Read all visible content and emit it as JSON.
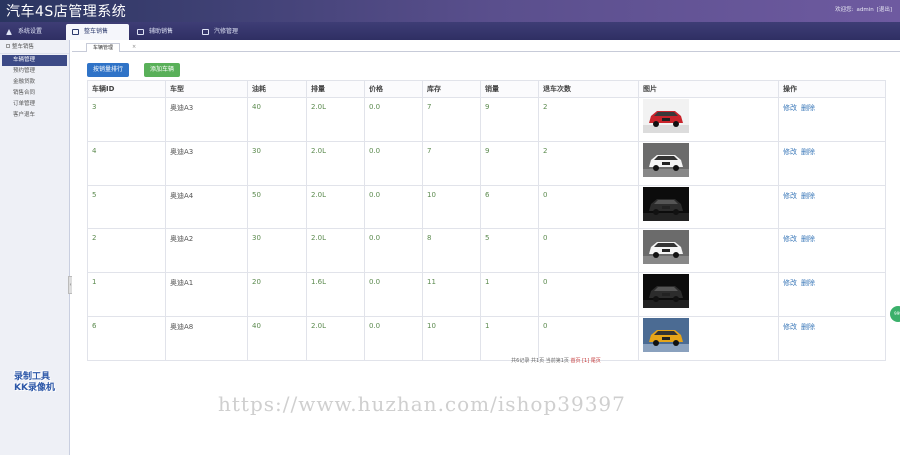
{
  "header": {
    "app_title": "汽车4S店管理系统",
    "welcome": "欢迎您:",
    "username": "admin",
    "logout": "[退出]"
  },
  "nav": {
    "tabs": [
      {
        "label": "系统设置",
        "icon": "home-icon"
      },
      {
        "label": "整车销售",
        "icon": "list-icon",
        "active": true
      },
      {
        "label": "辅助销售",
        "icon": "list-icon"
      },
      {
        "label": "汽修管理",
        "icon": "list-icon"
      }
    ]
  },
  "sidebar": {
    "heading": "整车销售",
    "items": [
      {
        "label": "车辆管理",
        "active": true
      },
      {
        "label": "预约管理"
      },
      {
        "label": "金融贷款"
      },
      {
        "label": "销售合同"
      },
      {
        "label": "订单管理"
      },
      {
        "label": "客户退车"
      }
    ]
  },
  "content": {
    "page_tab_label": "车辆管理",
    "page_tab_close": "×",
    "sort_button": "按销量排行",
    "add_button": "添加车辆"
  },
  "table": {
    "columns": [
      "车辆ID",
      "车型",
      "油耗",
      "排量",
      "价格",
      "库存",
      "销量",
      "退车次数",
      "图片",
      "操作"
    ],
    "rows": [
      {
        "id": "3",
        "model": "奥迪A3",
        "fuel": "40",
        "displacement": "2.0L",
        "price": "0.0",
        "stock": "7",
        "sales": "9",
        "returns": "2",
        "image": "red-car"
      },
      {
        "id": "4",
        "model": "奥迪A3",
        "fuel": "30",
        "displacement": "2.0L",
        "price": "0.0",
        "stock": "7",
        "sales": "9",
        "returns": "2",
        "image": "white-car"
      },
      {
        "id": "5",
        "model": "奥迪A4",
        "fuel": "50",
        "displacement": "2.0L",
        "price": "0.0",
        "stock": "10",
        "sales": "6",
        "returns": "0",
        "image": "black-car"
      },
      {
        "id": "2",
        "model": "奥迪A2",
        "fuel": "30",
        "displacement": "2.0L",
        "price": "0.0",
        "stock": "8",
        "sales": "5",
        "returns": "0",
        "image": "white-car"
      },
      {
        "id": "1",
        "model": "奥迪A1",
        "fuel": "20",
        "displacement": "1.6L",
        "price": "0.0",
        "stock": "11",
        "sales": "1",
        "returns": "0",
        "image": "black-car"
      },
      {
        "id": "6",
        "model": "奥迪A8",
        "fuel": "40",
        "displacement": "2.0L",
        "price": "0.0",
        "stock": "10",
        "sales": "1",
        "returns": "0",
        "image": "yellow-car"
      }
    ],
    "edit_label": "修改",
    "delete_label": "删除"
  },
  "pager": {
    "summary": "共6记录 共1页  当前第1页",
    "first": "首页",
    "current": "[1]",
    "last": "尾页"
  },
  "float_button": "999",
  "watermark": {
    "badge_line1": "录制工具",
    "badge_line2": "KK录像机",
    "url": "https://www.huzhan.com/ishop39397"
  },
  "colors": {
    "topbar": "#2a3560",
    "sidebar_active": "#3c4a86",
    "sort_button": "#2f73c7",
    "add_button": "#59b059",
    "link": "#3977b8"
  }
}
